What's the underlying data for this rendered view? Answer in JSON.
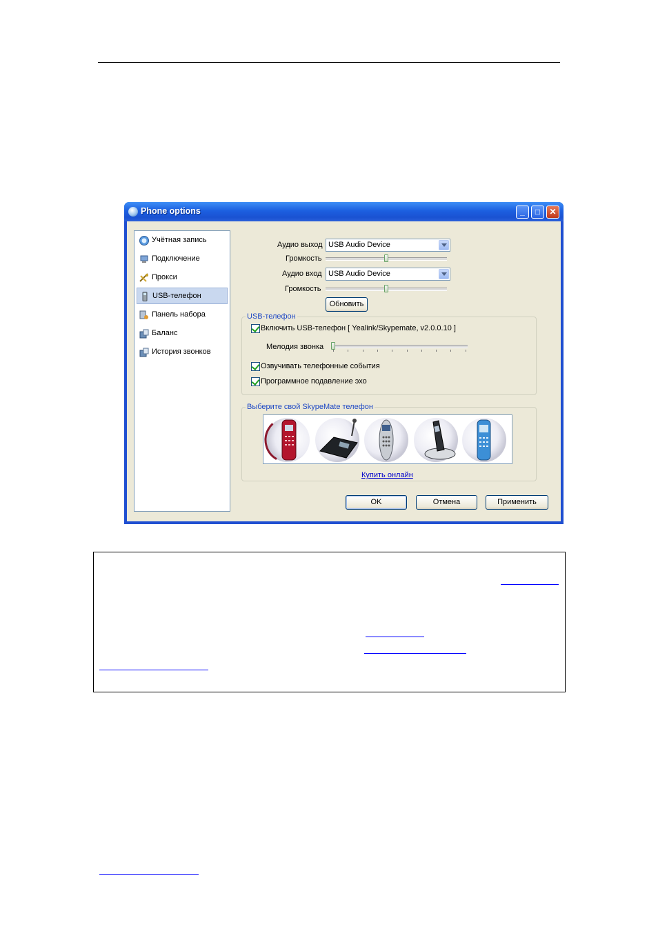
{
  "window": {
    "title": "Phone options",
    "controls": {
      "minimize": "_",
      "maximize": "□",
      "close": "✕"
    }
  },
  "sidebar": {
    "items": [
      {
        "label": "Учётная запись",
        "icon": "account-icon",
        "selected": false
      },
      {
        "label": "Подключение",
        "icon": "connection-icon",
        "selected": false
      },
      {
        "label": "Прокси",
        "icon": "proxy-icon",
        "selected": false
      },
      {
        "label": "USB-телефон",
        "icon": "usb-phone-icon",
        "selected": true
      },
      {
        "label": "Панель набора",
        "icon": "dialpad-icon",
        "selected": false
      },
      {
        "label": "Баланс",
        "icon": "balance-icon",
        "selected": false
      },
      {
        "label": "История звонков",
        "icon": "call-history-icon",
        "selected": false
      }
    ]
  },
  "audio": {
    "output_label": "Аудио выход",
    "output_value": "USB Audio Device",
    "output_volume_label": "Громкость",
    "output_volume_level": 0.5,
    "input_label": "Аудио вход",
    "input_value": "USB Audio Device",
    "input_volume_label": "Громкость",
    "input_volume_level": 0.5,
    "refresh_button": "Обновить"
  },
  "usb_group": {
    "title": "USB-телефон",
    "enable_label": "Включить USB-телефон [ Yealink/Skypemate, v2.0.0.10 ]",
    "enable_checked": true,
    "ringtone_label": "Мелодия звонка",
    "ringtone_level": 0,
    "announce_label": "Озвучивать телефонные события",
    "announce_checked": true,
    "echo_label": "Программное подавление эхо",
    "echo_checked": true
  },
  "skypemate_group": {
    "title": "Выберите свой SkypeMate телефон",
    "buy_link": "Купить онлайн"
  },
  "footer": {
    "ok": "OK",
    "cancel": "Отмена",
    "apply": "Применить"
  },
  "colors": {
    "titlebar": "#1c5fe0",
    "dialog_bg": "#ece9d8",
    "group_title": "#1f49c5",
    "link": "#0000cc"
  }
}
